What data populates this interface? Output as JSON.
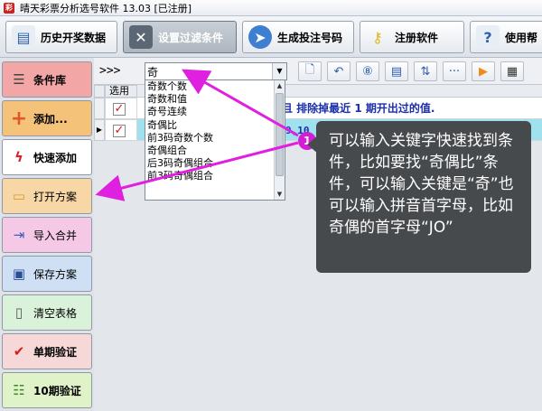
{
  "window": {
    "title": "晴天彩票分析选号软件 13.03  [已注册]"
  },
  "toolbar": [
    {
      "label": "历史开奖数据",
      "icon": "history-data-icon"
    },
    {
      "label": "设置过滤条件",
      "icon": "tools-icon"
    },
    {
      "label": "生成投注号码",
      "icon": "generate-icon"
    },
    {
      "label": "注册软件",
      "icon": "key-icon"
    },
    {
      "label": "使用帮",
      "icon": "help-icon"
    }
  ],
  "sidebar": [
    {
      "label": "条件库",
      "icon": "list-icon",
      "color": "#f2a6a6"
    },
    {
      "label": "添加...",
      "icon": "plus-icon",
      "color": "#f5c27a"
    },
    {
      "label": "快速添加",
      "icon": "lightning-icon",
      "color": "#ffffff"
    },
    {
      "label": "打开方案",
      "icon": "folder-icon",
      "color": "#f8d7a6"
    },
    {
      "label": "导入合并",
      "icon": "import-icon",
      "color": "#f5c8e6"
    },
    {
      "label": "保存方案",
      "icon": "save-icon",
      "color": "#cfe0f5"
    },
    {
      "label": "清空表格",
      "icon": "clear-icon",
      "color": "#d9f2d9"
    },
    {
      "label": "单期验证",
      "icon": "check-doc-icon",
      "color": "#f7d8d8"
    },
    {
      "label": "10期验证",
      "icon": "check-list-icon",
      "color": "#e0f2c8"
    }
  ],
  "search": {
    "prefix": ">>>",
    "value": "奇"
  },
  "grid": {
    "header_sel": "选用",
    "rows": [
      {
        "text": "且 排除掉最近 1 期开出过的值."
      },
      {
        "text": "9,10"
      }
    ]
  },
  "dropdown": {
    "items": [
      "奇数个数",
      "奇数和值",
      "奇号连续",
      "奇偶比",
      "前3码奇数个数",
      "奇偶组合",
      "后3码奇偶组合",
      "前3码奇偶组合"
    ]
  },
  "callout": {
    "badge": "1",
    "text": "可以输入关键字快速找到条件，比如要找“奇偶比”条件，可以输入关键是“奇”也可以输入拼音首字母，比如奇偶的首字母“JO”"
  },
  "colors": {
    "annotation": "#e020e0",
    "callout_bg": "#474a4d",
    "selected_row": "#9fe1ec"
  }
}
